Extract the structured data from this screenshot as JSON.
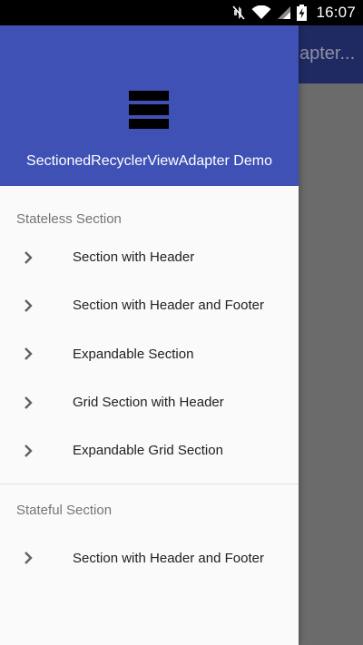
{
  "status_bar": {
    "time": "16:07",
    "icons": [
      "mute-icon",
      "wifi-icon",
      "signal-icon",
      "battery-charging-icon"
    ]
  },
  "background_app": {
    "toolbar_title": "apter..."
  },
  "drawer": {
    "header": {
      "title": "SectionedRecyclerViewAdapter Demo",
      "icon": "view-stream-icon"
    },
    "sections": [
      {
        "title": "Stateless Section",
        "items": [
          {
            "label": "Section with Header"
          },
          {
            "label": "Section with Header and Footer"
          },
          {
            "label": "Expandable Section"
          },
          {
            "label": "Grid Section with Header"
          },
          {
            "label": "Expandable Grid Section"
          }
        ]
      },
      {
        "title": "Stateful Section",
        "items": [
          {
            "label": "Section with Header and Footer"
          }
        ]
      }
    ]
  },
  "colors": {
    "primary": "#3f51b5",
    "primary_dark_scrim": "#1f2a63",
    "scrim": "#6b6b6b",
    "drawer_bg": "#fafafa",
    "section_title": "#757575",
    "item_text": "#212121"
  }
}
